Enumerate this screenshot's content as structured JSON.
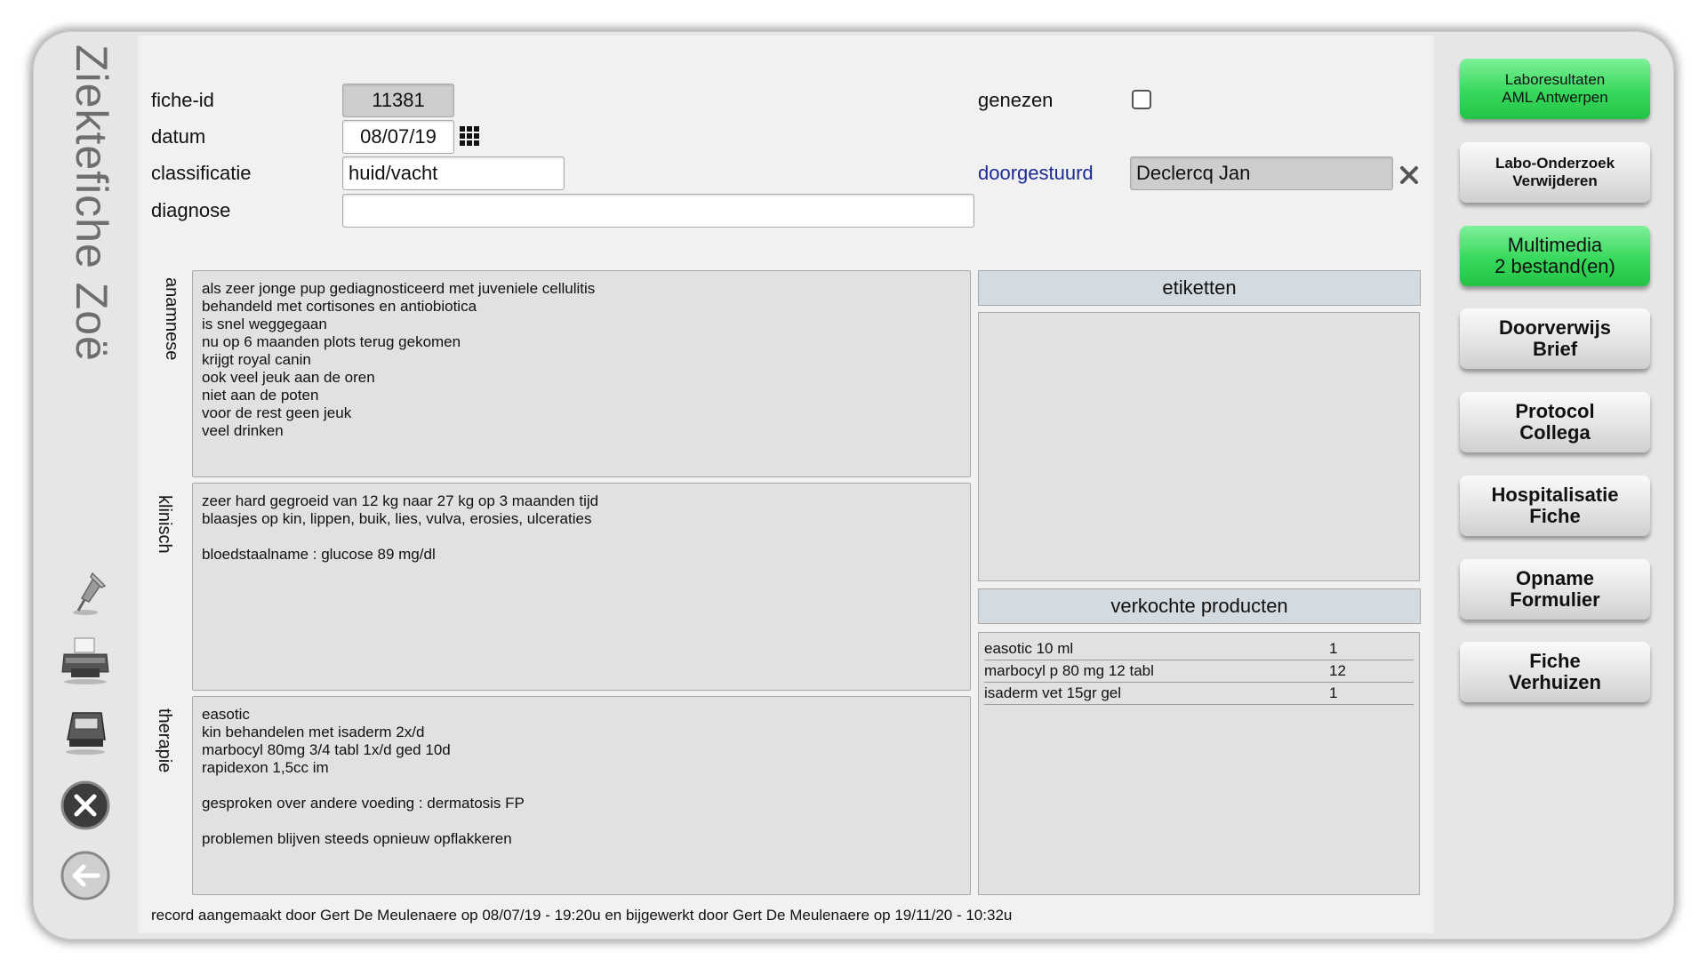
{
  "window": {
    "title": "Ziektefiche Zoë"
  },
  "form": {
    "fiche_id_label": "fiche-id",
    "fiche_id_value": "11381",
    "datum_label": "datum",
    "datum_value": "08/07/19",
    "classificatie_label": "classificatie",
    "classificatie_value": "huid/vacht",
    "diagnose_label": "diagnose",
    "diagnose_value": "",
    "genezen_label": "genezen",
    "genezen_checked": false,
    "doorgestuurd_label": "doorgestuurd",
    "doorgestuurd_value": "Declercq Jan"
  },
  "sections": {
    "anamnese_label": "anamnese",
    "anamnese_text": "als zeer jonge pup gediagnosticeerd met juveniele cellulitis\nbehandeld met cortisones en antiobiotica\nis snel weggegaan\nnu op 6 maanden plots terug gekomen\nkrijgt royal canin\nook veel jeuk aan de oren\nniet aan de poten\nvoor de rest geen jeuk\nveel drinken",
    "klinisch_label": "klinisch",
    "klinisch_text": "zeer hard gegroeid van 12 kg naar 27 kg op 3 maanden tijd\nblaasjes op kin, lippen, buik, lies, vulva, erosies, ulceraties\n\nbloedstaalname : glucose 89 mg/dl",
    "therapie_label": "therapie",
    "therapie_text": "easotic\nkin behandelen met isaderm 2x/d\nmarbocyl 80mg 3/4 tabl 1x/d ged 10d\nrapidexon 1,5cc im\n\ngesproken over andere voeding : dermatosis FP\n\nproblemen blijven steeds opnieuw opflakkeren"
  },
  "etiketten": {
    "header": "etiketten"
  },
  "producten": {
    "header": "verkochte producten",
    "rows": [
      {
        "name": "easotic 10 ml",
        "qty": "1"
      },
      {
        "name": "marbocyl p 80 mg 12 tabl",
        "qty": "12"
      },
      {
        "name": "isaderm vet 15gr gel",
        "qty": "1"
      }
    ]
  },
  "buttons": {
    "laboresultaten": "Laboresultaten\nAML Antwerpen",
    "labo_verwijderen": "Labo-Onderzoek\nVerwijderen",
    "multimedia": "Multimedia\n2 bestand(en)",
    "doorverwijs": "Doorverwijs\nBrief",
    "protocol": "Protocol\nCollega",
    "hospitalisatie": "Hospitalisatie\nFiche",
    "opname": "Opname\nFormulier",
    "verhuizen": "Fiche\nVerhuizen"
  },
  "footer": {
    "text": "record aangemaakt door Gert De Meulenaere op 08/07/19 - 19:20u en bijgewerkt door Gert De Meulenaere op 19/11/20 - 10:32u"
  },
  "icons": [
    "pin-icon",
    "printer-icon",
    "label-printer-icon",
    "close-icon",
    "back-arrow-icon"
  ],
  "colors": {
    "green_button": "#37d85b",
    "link": "#1c2b8f",
    "header_bar": "#d3dae0"
  }
}
